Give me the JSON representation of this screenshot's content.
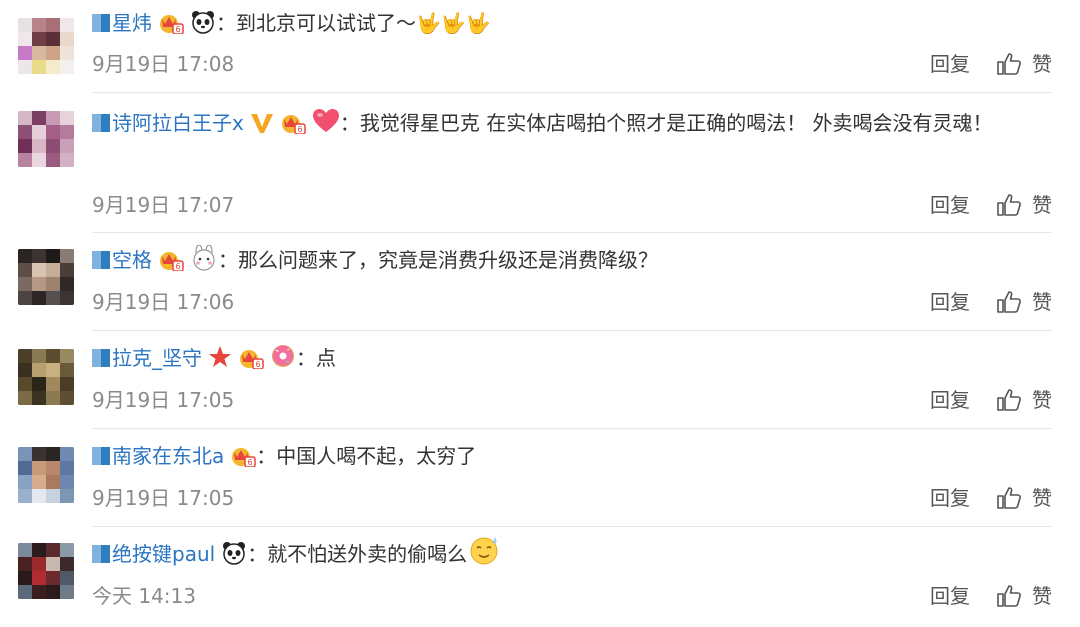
{
  "comments": [
    {
      "user": "星炜",
      "text": "到北京可以试试了～🤟🤟🤟",
      "time": "9月19日 17:08",
      "reply": "回复",
      "like": "赞",
      "badges": [
        "vip-crown-icon",
        "panda-icon"
      ]
    },
    {
      "user": "诗阿拉白王子x",
      "text": "我觉得星巴克 在实体店喝拍个照才是正确的喝法！ 外卖喝会没有灵魂！",
      "time": "9月19日 17:07",
      "reply": "回复",
      "like": "赞",
      "badges": [
        "verified-v-icon",
        "vip-crown-icon",
        "heart-icon"
      ]
    },
    {
      "user": "空格",
      "text": "那么问题来了，究竟是消费升级还是消费降级？",
      "time": "9月19日 17:06",
      "reply": "回复",
      "like": "赞",
      "badges": [
        "vip-crown-icon",
        "bunny-icon"
      ]
    },
    {
      "user": "拉克_坚守",
      "text": "点",
      "time": "9月19日 17:05",
      "reply": "回复",
      "like": "赞",
      "badges": [
        "star-icon",
        "vip-crown-icon",
        "donut-icon"
      ]
    },
    {
      "user": "南家在东北a",
      "text": "中国人喝不起，太穷了",
      "time": "9月19日 17:05",
      "reply": "回复",
      "like": "赞",
      "badges": [
        "vip-crown-icon"
      ]
    },
    {
      "user": "绝按键paul",
      "text": "就不怕送外卖的偷喝么",
      "time": "今天 14:13",
      "reply": "回复",
      "like": "赞",
      "badges": [
        "panda-icon",
        "sweat-smile-icon"
      ]
    }
  ],
  "colors": {
    "username": "#2b75c2",
    "time": "#8a8a8a",
    "text": "#333333",
    "divider": "#e6e6e6"
  }
}
